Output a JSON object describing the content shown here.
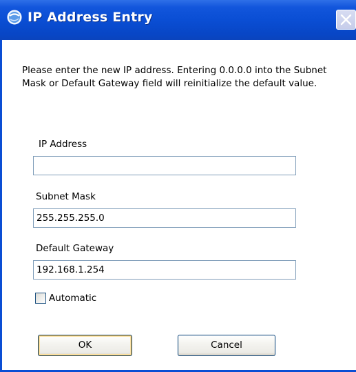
{
  "window": {
    "title": "IP Address Entry",
    "accent": "#0a4ed4",
    "title_icon": "globe-icon",
    "close_icon": "close-icon"
  },
  "instructions": "Please enter the new IP address.  Entering 0.0.0.0 into the Subnet Mask or Default Gateway field will reinitialize the default value.",
  "fields": {
    "ip_address": {
      "label": "IP Address",
      "value": ""
    },
    "subnet_mask": {
      "label": "Subnet Mask",
      "value": "255.255.255.0"
    },
    "default_gateway": {
      "label": "Default Gateway",
      "value": "192.168.1.254"
    }
  },
  "automatic": {
    "label": "Automatic",
    "checked": false
  },
  "buttons": {
    "ok": "OK",
    "cancel": "Cancel"
  }
}
